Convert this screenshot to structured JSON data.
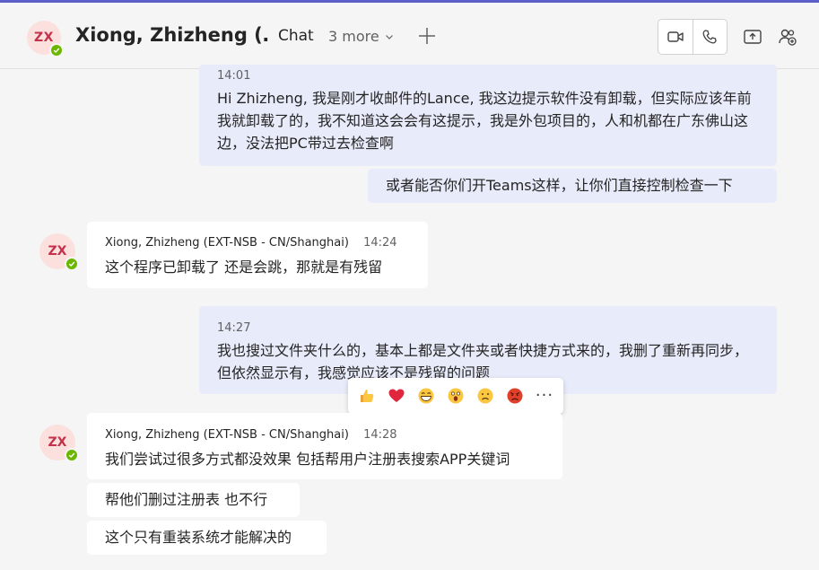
{
  "header": {
    "avatar_initials": "ZX",
    "contact_name": "Xiong, Zhizheng (…",
    "tab_chat": "Chat",
    "tab_more": "3 more"
  },
  "messages": {
    "m1": {
      "time": "14:01",
      "text": "Hi Zhizheng, 我是刚才收邮件的Lance, 我这边提示软件没有卸载，但实际应该年前我就卸载了的，我不知道这会会有这提示，我是外包项目的，人和机都在广东佛山这边，没法把PC带过去检查啊"
    },
    "m2": {
      "text": "或者能否你们开Teams这样，让你们直接控制检查一下"
    },
    "m3": {
      "avatar_initials": "ZX",
      "sender": "Xiong, Zhizheng (EXT-NSB - CN/Shanghai)",
      "time": "14:24",
      "text": "这个程序已卸载了 还是会跳，那就是有残留"
    },
    "m4": {
      "time": "14:27",
      "text": "我也搜过文件夹什么的，基本上都是文件夹或者快捷方式来的，我删了重新再同步，但依然显示有，我感觉应该不是残留的问题"
    },
    "m5": {
      "avatar_initials": "ZX",
      "sender": "Xiong, Zhizheng (EXT-NSB - CN/Shanghai)",
      "time": "14:28",
      "text": "我们尝试过很多方式都没效果 包括帮用户注册表搜索APP关键词"
    },
    "m6": {
      "text": "帮他们删过注册表 也不行"
    },
    "m7": {
      "text": "这个只有重装系统才能解决的"
    }
  },
  "reactions": {
    "icons": [
      "thumbs-up-icon",
      "heart-icon",
      "laugh-icon",
      "surprised-icon",
      "sad-icon",
      "angry-icon",
      "more-options-icon"
    ],
    "more": "···"
  },
  "colors": {
    "accent": "#5b5fc7",
    "my_bubble": "#e8ebfa",
    "avatar_bg": "#fbe0dd",
    "avatar_text": "#c4314b",
    "presence": "#6bb700"
  }
}
